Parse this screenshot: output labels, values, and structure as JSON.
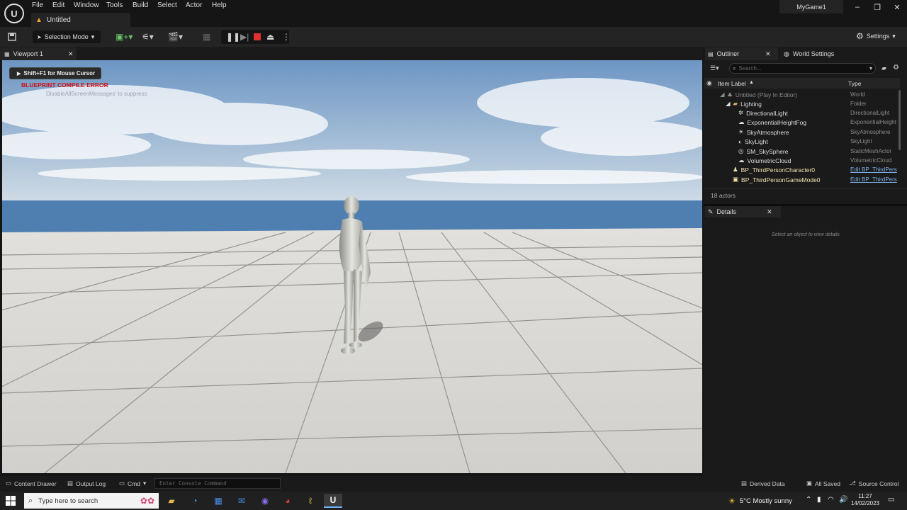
{
  "menu": [
    "File",
    "Edit",
    "Window",
    "Tools",
    "Build",
    "Select",
    "Actor",
    "Help"
  ],
  "document_tab": "Untitled",
  "project_name": "MyGame1",
  "toolbar": {
    "selection_mode": "Selection Mode",
    "settings": "Settings"
  },
  "viewport": {
    "tab": "Viewport 1",
    "mouse_hint": "Shift+F1 for Mouse Cursor",
    "error": "BLUEPRINT COMPILE ERROR",
    "suppress": "DisableAllScreenMessages' to suppress"
  },
  "outliner": {
    "tab": "Outliner",
    "world_tab": "World Settings",
    "search_placeholder": "Search...",
    "col_label": "Item Label",
    "col_type": "Type",
    "rows": [
      {
        "label": "Untitled (Play In Editor)",
        "type": "World"
      },
      {
        "label": "Lighting",
        "type": "Folder"
      },
      {
        "label": "DirectionalLight",
        "type": "DirectionalLight"
      },
      {
        "label": "ExponentialHeightFog",
        "type": "ExponentialHeight"
      },
      {
        "label": "SkyAtmosphere",
        "type": "SkyAtmosphere"
      },
      {
        "label": "SkyLight",
        "type": "SkyLight"
      },
      {
        "label": "SM_SkySphere",
        "type": "StaticMeshActor"
      },
      {
        "label": "VolumetricCloud",
        "type": "VolumetricCloud"
      },
      {
        "label": "BP_ThirdPersonCharacter0",
        "type": "Edit BP_ThirdPers"
      },
      {
        "label": "BP_ThirdPersonGameMode0",
        "type": "Edit BP_ThirdPers"
      }
    ],
    "actor_count": "18 actors"
  },
  "details": {
    "tab": "Details",
    "empty": "Select an object to view details"
  },
  "bottom": {
    "content_drawer": "Content Drawer",
    "output_log": "Output Log",
    "cmd": "Cmd",
    "console_placeholder": "Enter Console Command",
    "derived_data": "Derived Data",
    "all_saved": "All Saved",
    "source_control": "Source Control"
  },
  "taskbar": {
    "search": "Type here to search",
    "weather": "5°C  Mostly sunny",
    "time": "11:27",
    "date": "14/02/2023"
  },
  "colors": {
    "error": "#d01010",
    "link": "#7eb0e8",
    "sky_top": "#6d96c4",
    "floor": "#dcdad8"
  }
}
